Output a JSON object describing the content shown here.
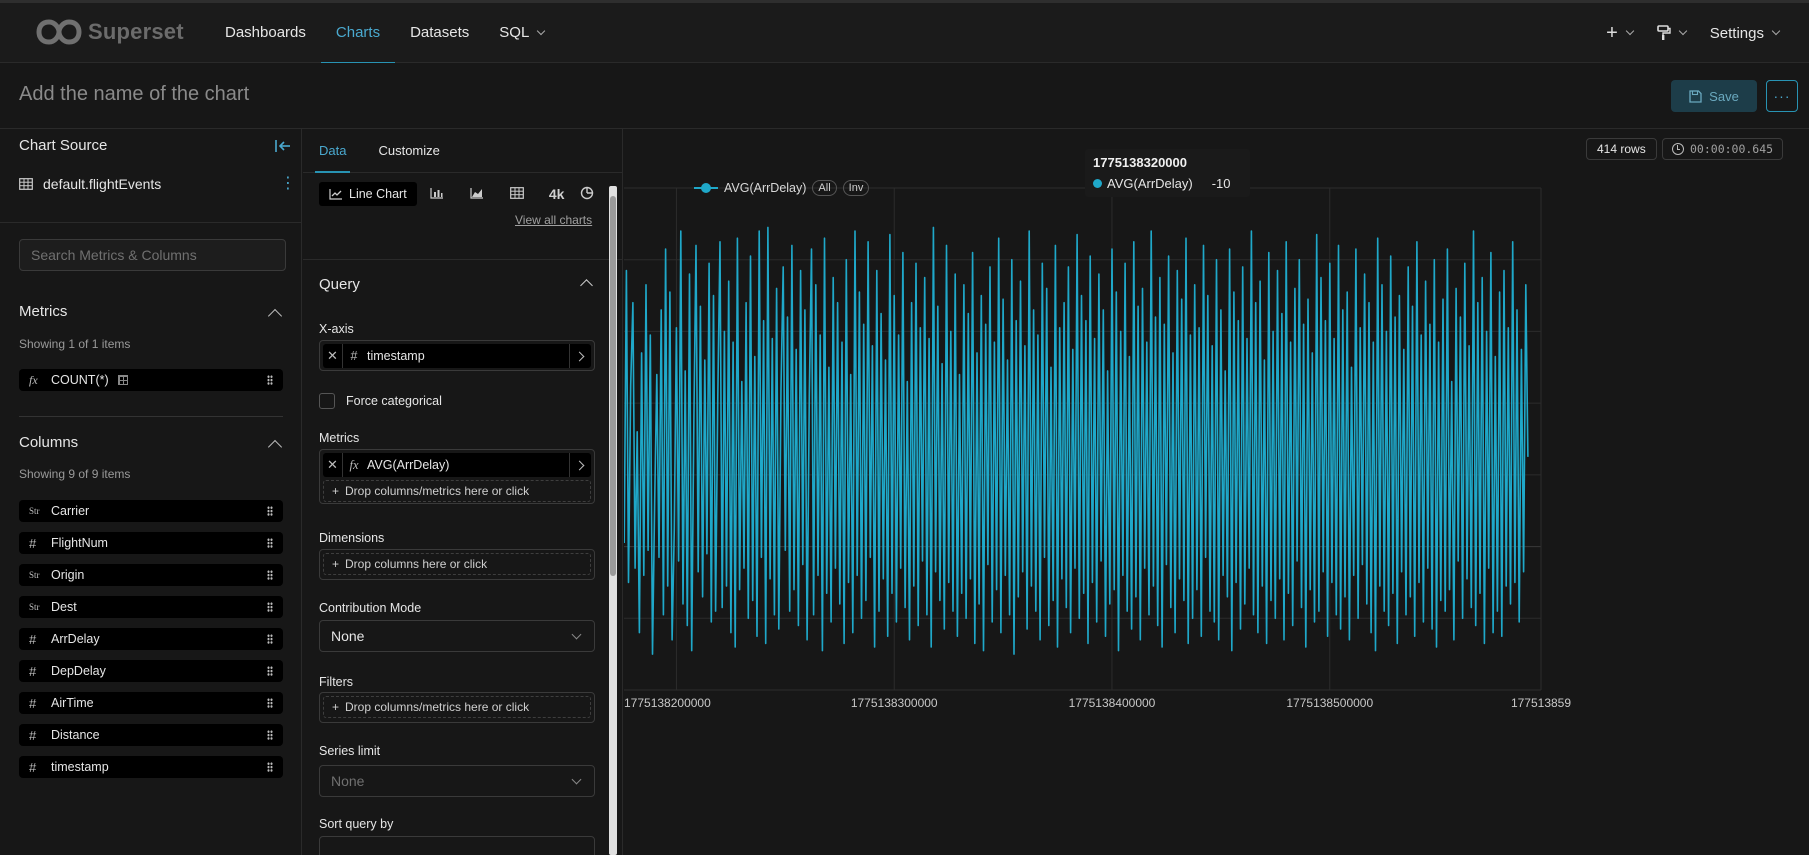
{
  "nav": {
    "brand": "Superset",
    "items": [
      {
        "label": "Dashboards"
      },
      {
        "label": "Charts"
      },
      {
        "label": "Datasets"
      },
      {
        "label": "SQL"
      }
    ],
    "settings_label": "Settings"
  },
  "header": {
    "title_placeholder": "Add the name of the chart",
    "save_label": "Save"
  },
  "left_panel": {
    "title": "Chart Source",
    "dataset": "default.flightEvents",
    "search_placeholder": "Search Metrics & Columns",
    "metrics": {
      "heading": "Metrics",
      "showing": "Showing 1 of 1 items",
      "items": [
        {
          "type": "fx",
          "label": "COUNT(*)"
        }
      ]
    },
    "columns": {
      "heading": "Columns",
      "showing": "Showing 9 of 9 items",
      "items": [
        {
          "type": "Str",
          "label": "Carrier"
        },
        {
          "type": "#",
          "label": "FlightNum"
        },
        {
          "type": "Str",
          "label": "Origin"
        },
        {
          "type": "Str",
          "label": "Dest"
        },
        {
          "type": "#",
          "label": "ArrDelay"
        },
        {
          "type": "#",
          "label": "DepDelay"
        },
        {
          "type": "#",
          "label": "AirTime"
        },
        {
          "type": "#",
          "label": "Distance"
        },
        {
          "type": "#",
          "label": "timestamp"
        }
      ]
    }
  },
  "control_panel": {
    "tabs": [
      {
        "label": "Data"
      },
      {
        "label": "Customize"
      }
    ],
    "viz_type": "Line Chart",
    "viz_icon_big": "4k",
    "view_all": "View all charts",
    "query_heading": "Query",
    "x_axis": {
      "label": "X-axis",
      "value": "timestamp",
      "type": "#"
    },
    "force_categorical": "Force categorical",
    "metrics": {
      "label": "Metrics",
      "value": "AVG(ArrDelay)",
      "type": "fx",
      "drop": "Drop columns/metrics here or click"
    },
    "dimensions": {
      "label": "Dimensions",
      "drop": "Drop columns here or click"
    },
    "contribution_mode": {
      "label": "Contribution Mode",
      "value": "None"
    },
    "filters": {
      "label": "Filters",
      "drop": "Drop columns/metrics here or click"
    },
    "series_limit": {
      "label": "Series limit",
      "value": "None"
    },
    "sort_query_by": {
      "label": "Sort query by"
    }
  },
  "chart_panel": {
    "rows": "414 rows",
    "timer": "00:00:00.645",
    "tooltip": {
      "title": "1775138320000",
      "series": "AVG(ArrDelay)",
      "value": "-10"
    },
    "legend": {
      "series": "AVG(ArrDelay)",
      "all": "All",
      "inv": "Inv"
    },
    "line_color": "#1fa8c9"
  },
  "chart_data": {
    "type": "line",
    "xlabel": "",
    "ylabel": "",
    "x_range": [
      1775138175000,
      1775138597000
    ],
    "ylim": [
      -40,
      100
    ],
    "y_ticks": [
      -40,
      -20,
      0,
      20,
      40,
      60,
      80,
      100
    ],
    "x_ticks": [
      1775138200000,
      1775138300000,
      1775138400000,
      1775138500000,
      1775138597000
    ],
    "x_tick_labels": [
      "1775138200000",
      "1775138300000",
      "1775138400000",
      "1775138500000",
      "177513859"
    ],
    "grid": true,
    "legend_position": "top-left",
    "series": [
      {
        "name": "AVG(ArrDelay)",
        "x_start": 1775138176000,
        "x_step": 1000,
        "values": [
          1,
          77,
          -10,
          45,
          68,
          -6,
          32,
          -24,
          54,
          -8,
          73,
          -1,
          59,
          -30,
          13,
          48,
          -3,
          66,
          -19,
          83,
          -11,
          71,
          -26,
          5,
          61,
          -4,
          88,
          -16,
          49,
          -22,
          76,
          -29,
          36,
          84,
          -7,
          67,
          -14,
          52,
          -2,
          79,
          -21,
          70,
          -18,
          42,
          85,
          -17,
          60,
          -11,
          74,
          -24,
          57,
          -28,
          86,
          -12,
          46,
          -6,
          68,
          -20,
          81,
          -15,
          53,
          -25,
          88,
          -3,
          63,
          -27,
          89,
          -9,
          58,
          -19,
          72,
          -23,
          44,
          78,
          -1,
          64,
          -18,
          84,
          -12,
          55,
          -22,
          77,
          -5,
          66,
          -26,
          42,
          83,
          -19,
          73,
          -8,
          59,
          -29,
          86,
          -13,
          50,
          -21,
          75,
          -6,
          68,
          -16,
          57,
          -27,
          80,
          -10,
          48,
          -24,
          88,
          -8,
          71,
          -20,
          62,
          -15,
          85,
          -3,
          56,
          -28,
          77,
          -18,
          65,
          -9,
          52,
          -25,
          87,
          -13,
          70,
          -21,
          59,
          -6,
          82,
          -17,
          46,
          -26,
          68,
          -11,
          79,
          -22,
          61,
          -4,
          75,
          -19,
          58,
          -28,
          89,
          -7,
          67,
          -15,
          51,
          -23,
          84,
          -10,
          60,
          -18,
          76,
          -25,
          48,
          -13,
          73,
          -20,
          65,
          -9,
          82,
          -27,
          54,
          -16,
          70,
          -29,
          62,
          -5,
          78,
          -21,
          57,
          -12,
          86,
          -24,
          69,
          -8,
          52,
          -19,
          80,
          -30,
          63,
          -14,
          74,
          -7,
          56,
          -23,
          88,
          -11,
          66,
          -18,
          59,
          -26,
          79,
          -3,
          72,
          -22,
          50,
          -15,
          84,
          -28,
          61,
          -9,
          68,
          -17,
          78,
          -24,
          55,
          -6,
          87,
          -20,
          70,
          -13,
          63,
          -27,
          81,
          -10,
          58,
          -21,
          76,
          -4,
          66,
          -25,
          49,
          -16,
          83,
          -12,
          71,
          -29,
          60,
          -8,
          79,
          -18,
          53,
          -23,
          85,
          -14,
          67,
          -26,
          72,
          -6,
          57,
          -19,
          88,
          -11,
          64,
          -22,
          75,
          -28,
          62,
          -5,
          81,
          -17,
          54,
          -24,
          77,
          -9,
          69,
          -15,
          86,
          -27,
          59,
          -20,
          73,
          -12,
          61,
          -25,
          84,
          -3,
          70,
          -18,
          56,
          -21,
          80,
          -26,
          66,
          -8,
          49,
          -14,
          83,
          -29,
          71,
          -10,
          63,
          -23,
          78,
          -16,
          58,
          -6,
          88,
          -19,
          68,
          -24,
          74,
          -11,
          52,
          -27,
          82,
          -15,
          60,
          -20,
          77,
          -9,
          65,
          -26,
          85,
          -13,
          57,
          -22,
          72,
          -4,
          80,
          -17,
          62,
          -28,
          69,
          -12,
          54,
          -21,
          87,
          -18,
          75,
          -7,
          63,
          -25,
          79,
          -10,
          58,
          -19,
          84,
          -23,
          66,
          -14,
          71,
          -26,
          50,
          -8,
          83,
          -20,
          61,
          -5,
          76,
          -16,
          68,
          -24,
          57,
          -29,
          86,
          -11,
          73,
          -18,
          60,
          -22,
          81,
          -13,
          64,
          -27,
          70,
          -7,
          55,
          -19,
          78,
          -14,
          67,
          -25,
          85,
          -10,
          59,
          -21,
          74,
          -6,
          62,
          -23,
          80,
          -28,
          57,
          -15,
          69,
          -18,
          83,
          -12,
          46,
          -26,
          72,
          -4,
          64,
          -20,
          79,
          -9,
          56,
          -17,
          88,
          -22,
          68,
          -13,
          75,
          -27,
          60,
          -6,
          82,
          -24,
          53,
          -18,
          71,
          -25,
          77,
          -11,
          61,
          -16,
          85,
          -10,
          66,
          -21,
          55,
          -7,
          73,
          25
        ]
      }
    ]
  }
}
